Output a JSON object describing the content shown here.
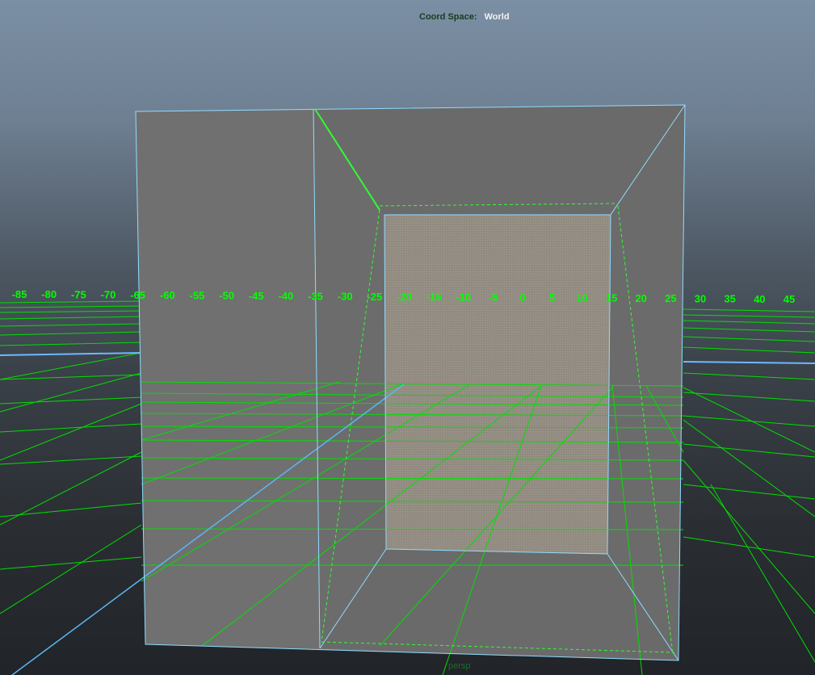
{
  "hud": {
    "coord_space_label": "Coord Space:",
    "coord_space_value": "World"
  },
  "camera": {
    "name": "persp"
  },
  "ruler": {
    "labels": [
      "-85",
      "-80",
      "-75",
      "-70",
      "-65",
      "-60",
      "-55",
      "-50",
      "-45",
      "-40",
      "-35",
      "-30",
      "-25",
      "-20",
      "-15",
      "-10",
      "-5",
      "0",
      "5",
      "10",
      "15",
      "20",
      "25",
      "30",
      "35",
      "40",
      "45"
    ]
  },
  "colors": {
    "grid": "#00ff00",
    "wireframe": "#7fd8ff",
    "axis_x": "#4f9df0",
    "ruler_label": "#00ff00",
    "surface": "#6f6f6f",
    "back_face": "#989186"
  }
}
